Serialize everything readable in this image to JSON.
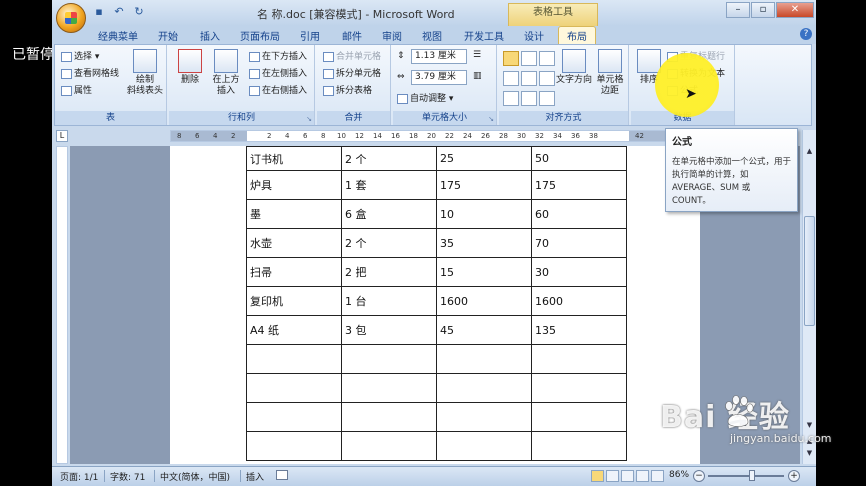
{
  "overlay": {
    "paused_label": "已暂停"
  },
  "window": {
    "title": "名 称.doc [兼容模式] - Microsoft Word",
    "context_tab": "表格工具",
    "controls": {
      "minimize": "–",
      "restore": "▫",
      "close": "✕"
    }
  },
  "qat": {
    "save": "▪",
    "undo": "↶",
    "redo": "↻"
  },
  "tabs": [
    "经典菜单",
    "开始",
    "插入",
    "页面布局",
    "引用",
    "邮件",
    "审阅",
    "视图",
    "开发工具",
    "设计",
    "布局"
  ],
  "active_tab": "布局",
  "help": "?",
  "ribbon": {
    "table_group": {
      "label": "表",
      "select": "选择 ▾",
      "gridlines": "查看网格线",
      "properties": "属性",
      "draw_diag": "绘制\n斜线表头"
    },
    "rows_cols_group": {
      "label": "行和列",
      "delete": "删除",
      "insert_above": "在上方\n插入",
      "insert_below": "在下方插入",
      "insert_left": "在左侧插入",
      "insert_right": "在右侧插入"
    },
    "merge_group": {
      "label": "合并",
      "merge": "合并单元格",
      "split": "拆分单元格",
      "split_table": "拆分表格"
    },
    "cell_size_group": {
      "label": "单元格大小",
      "height": "1.13 厘米",
      "width": "3.79 厘米",
      "autofit": "自动调整 ▾"
    },
    "alignment_group": {
      "label": "对齐方式",
      "text_direction": "文字方向",
      "cell_margins": "单元格\n边距"
    },
    "data_group": {
      "label": "数据",
      "sort": "排序",
      "repeat_header": "重复标题行",
      "convert_text": "转换为文本",
      "formula": "公式"
    }
  },
  "ruler_numbers": [
    "8",
    "6",
    "4",
    "2",
    "",
    "2",
    "4",
    "6",
    "8",
    "10",
    "12",
    "14",
    "16",
    "18",
    "20",
    "22",
    "24",
    "26",
    "28",
    "30",
    "32",
    "34",
    "36",
    "38",
    "",
    "42"
  ],
  "tooltip": {
    "title": "公式",
    "body": "在单元格中添加一个公式，用于执行简单的计算，如 AVERAGE、SUM 或 COUNT。"
  },
  "table": {
    "rows": [
      [
        "订书机",
        "2 个",
        "25",
        "50"
      ],
      [
        "炉具",
        "1 套",
        "175",
        "175"
      ],
      [
        "墨",
        "6 盒",
        "10",
        "60"
      ],
      [
        "水壶",
        "2 个",
        "35",
        "70"
      ],
      [
        "扫帚",
        "2 把",
        "15",
        "30"
      ],
      [
        "复印机",
        "1 台",
        "1600",
        "1600"
      ],
      [
        "A4 纸",
        "3 包",
        "45",
        "135"
      ],
      [
        "",
        "",
        "",
        ""
      ],
      [
        "",
        "",
        "",
        ""
      ],
      [
        "",
        "",
        "",
        ""
      ],
      [
        "",
        "",
        "",
        ""
      ]
    ]
  },
  "statusbar": {
    "page": "页面: 1/1",
    "words": "字数: 71",
    "language": "中文(简体，中国)",
    "insert_mode": "插入",
    "zoom": "86%",
    "zoom_minus": "−",
    "zoom_plus": "+"
  },
  "watermark": {
    "text": "Bai 经验",
    "url": "jingyan.baidu.com"
  }
}
